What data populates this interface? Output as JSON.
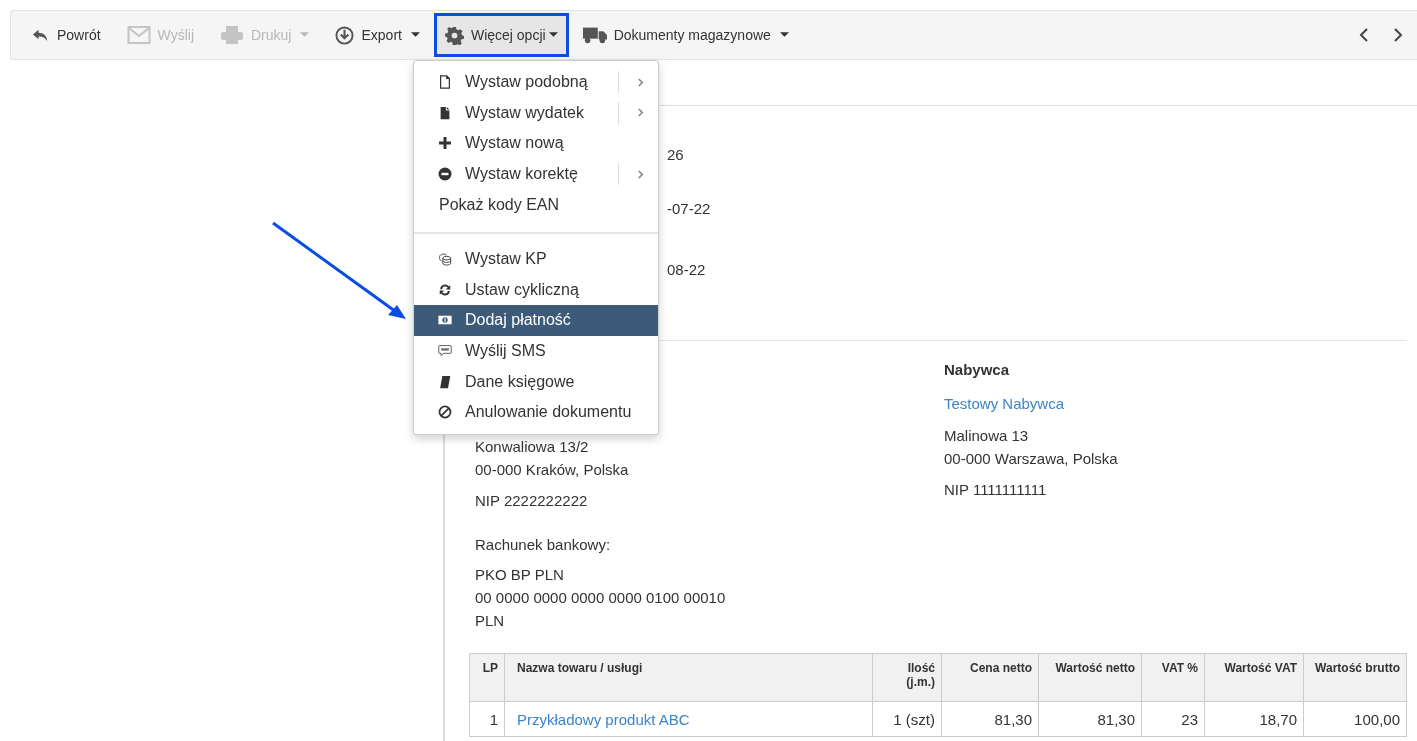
{
  "toolbar": {
    "buttons": [
      {
        "label": "Powrót",
        "disabled": false,
        "caret": false,
        "highlighted": false
      },
      {
        "label": "Wyślij",
        "disabled": true,
        "caret": false,
        "highlighted": false
      },
      {
        "label": "Drukuj",
        "disabled": true,
        "caret": true,
        "highlighted": false
      },
      {
        "label": "Export",
        "disabled": false,
        "caret": true,
        "highlighted": false
      },
      {
        "label": "Więcej opcji",
        "disabled": false,
        "caret": true,
        "highlighted": true
      },
      {
        "label": "Dokumenty magazynowe",
        "disabled": false,
        "caret": true,
        "highlighted": false
      }
    ]
  },
  "menu": {
    "items": [
      {
        "kind": "item",
        "label": "Wystaw podobną",
        "submenu": true,
        "selected": false
      },
      {
        "kind": "item",
        "label": "Wystaw wydatek",
        "submenu": true,
        "selected": false
      },
      {
        "kind": "item",
        "label": "Wystaw nową",
        "submenu": false,
        "selected": false
      },
      {
        "kind": "item",
        "label": "Wystaw korektę",
        "submenu": true,
        "selected": false
      },
      {
        "kind": "plain",
        "label": "Pokaż kody EAN",
        "submenu": false,
        "selected": false
      },
      {
        "kind": "divider"
      },
      {
        "kind": "item",
        "label": "Wystaw KP",
        "submenu": false,
        "selected": false
      },
      {
        "kind": "item",
        "label": "Ustaw cykliczną",
        "submenu": false,
        "selected": false
      },
      {
        "kind": "item",
        "label": "Dodaj płatność",
        "submenu": false,
        "selected": true
      },
      {
        "kind": "item",
        "label": "Wyślij SMS",
        "submenu": false,
        "selected": false
      },
      {
        "kind": "item",
        "label": "Dane księgowe",
        "submenu": false,
        "selected": false
      },
      {
        "kind": "item",
        "label": "Anulowanie dokumentu",
        "submenu": false,
        "selected": false
      }
    ]
  },
  "annotation": {
    "arrow": true
  },
  "document": {
    "header_values": [
      "26",
      "-07-22",
      "08-22"
    ],
    "seller": {
      "address": "Konwaliowa 13/2",
      "city": "00-000 Kraków, Polska",
      "nip": "NIP 2222222222"
    },
    "buyer": {
      "heading": "Nabywca",
      "name": "Testowy Nabywca",
      "address": "Malinowa 13",
      "city": "00-000 Warszawa, Polska",
      "nip": "NIP 1111111111"
    },
    "bank": {
      "heading": "Rachunek bankowy:",
      "lines": [
        "PKO BP PLN",
        "00 0000 0000 0000 0000 0100 00010",
        "PLN"
      ]
    },
    "table": {
      "columns": [
        "LP",
        "Nazwa towaru / usługi",
        "Ilość (j.m.)",
        "Cena netto",
        "Wartość netto",
        "VAT %",
        "Wartość VAT",
        "Wartość brutto"
      ],
      "rows": [
        [
          "1",
          "Przykładowy produkt ABC",
          "1 (szt)",
          "81,30",
          "81,30",
          "23",
          "18,70",
          "100,00"
        ]
      ]
    }
  }
}
